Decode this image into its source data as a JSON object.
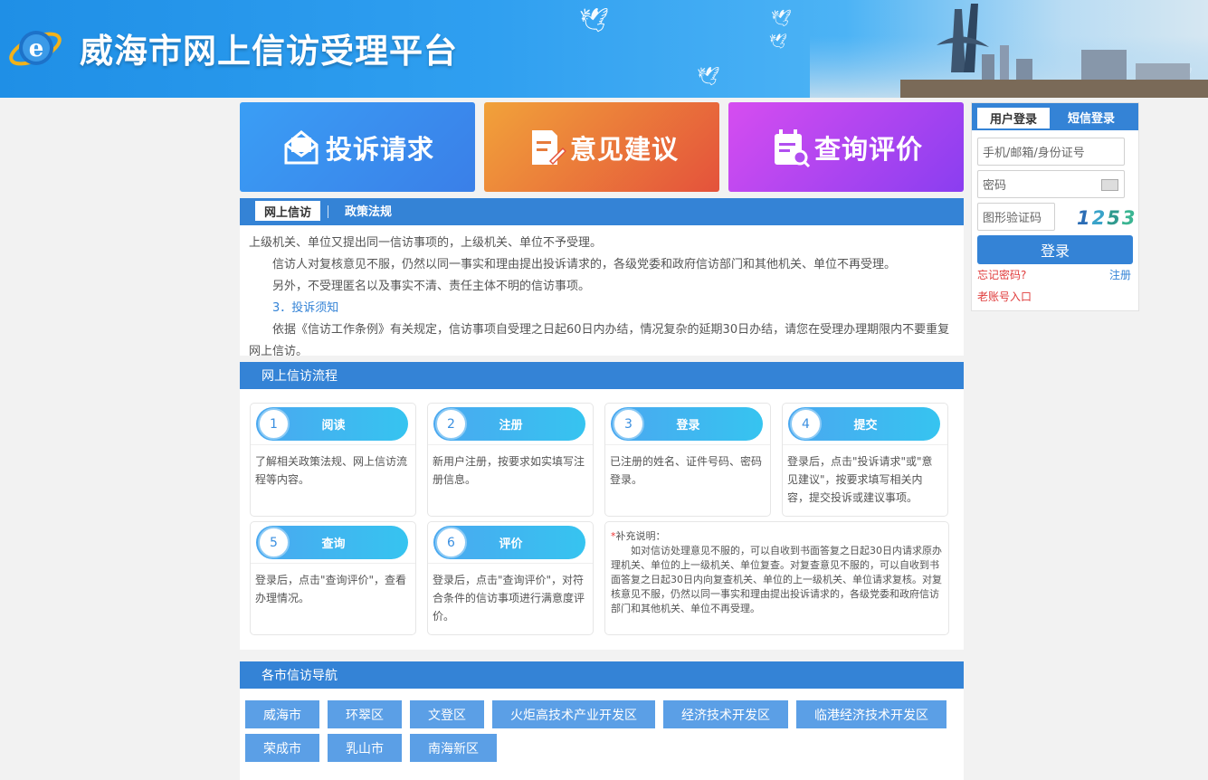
{
  "header": {
    "title": "威海市网上信访受理平台",
    "logo_icon": "ie-e-logo-icon"
  },
  "cards": [
    {
      "label": "投诉请求",
      "icon": "envelope-icon"
    },
    {
      "label": "意见建议",
      "icon": "document-pen-icon"
    },
    {
      "label": "查询评价",
      "icon": "calendar-search-icon"
    }
  ],
  "notice": {
    "tabs": [
      "网上信访",
      "政策法规"
    ],
    "lines": [
      "上级机关、单位又提出同一信访事项的，上级机关、单位不予受理。",
      "信访人对复核意见不服，仍然以同一事实和理由提出投诉请求的，各级党委和政府信访部门和其他机关、单位不再受理。",
      "另外，不受理匿名以及事实不清、责任主体不明的信访事项。",
      "3．投诉须知",
      "依据《信访工作条例》有关规定，信访事项自受理之日起60日内办结，情况复杂的延期30日办结，请您在受理办理期限内不要重复网上信访。"
    ]
  },
  "process": {
    "title": "网上信访流程",
    "steps": [
      {
        "num": "1",
        "title": "阅读",
        "desc": "了解相关政策法规、网上信访流程等内容。"
      },
      {
        "num": "2",
        "title": "注册",
        "desc": "新用户注册，按要求如实填写注册信息。"
      },
      {
        "num": "3",
        "title": "登录",
        "desc": "已注册的姓名、证件号码、密码登录。"
      },
      {
        "num": "4",
        "title": "提交",
        "desc": "登录后，点击\"投诉请求\"或\"意见建议\"，按要求填写相关内容，提交投诉或建议事项。"
      },
      {
        "num": "5",
        "title": "查询",
        "desc": "登录后，点击\"查询评价\"，查看办理情况。"
      },
      {
        "num": "6",
        "title": "评价",
        "desc": "登录后，点击\"查询评价\"，对符合条件的信访事项进行满意度评价。"
      }
    ],
    "supplement": {
      "asterisk": "*",
      "label": "补充说明：",
      "text": "如对信访处理意见不服的，可以自收到书面答复之日起30日内请求原办理机关、单位的上一级机关、单位复查。对复查意见不服的，可以自收到书面答复之日起30日内向复查机关、单位的上一级机关、单位请求复核。对复核意见不服，仍然以同一事实和理由提出投诉请求的，各级党委和政府信访部门和其他机关、单位不再受理。"
    }
  },
  "nav": {
    "title": "各市信访导航",
    "items": [
      "威海市",
      "环翠区",
      "文登区",
      "火炬高技术产业开发区",
      "经济技术开发区",
      "临港经济技术开发区",
      "荣成市",
      "乳山市",
      "南海新区"
    ]
  },
  "login": {
    "tabs": [
      "用户登录",
      "短信登录"
    ],
    "account_placeholder": "手机/邮箱/身份证号",
    "password_placeholder": "密码",
    "captcha_placeholder": "图形验证码",
    "captcha_code": [
      "1",
      "2",
      "5",
      "3"
    ],
    "login_button": "登录",
    "forgot": "忘记密码?",
    "register": "注册",
    "old_account": "老账号入口"
  },
  "colors": {
    "primary": "#3483d6",
    "nav_button": "#5b9fe6",
    "link_red": "#e03c3c"
  }
}
